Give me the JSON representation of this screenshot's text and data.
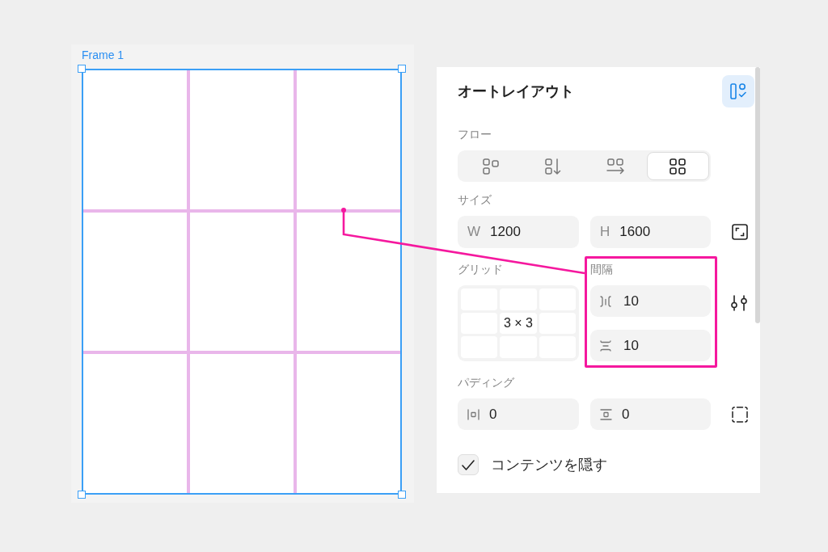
{
  "canvas": {
    "frame": {
      "label": "Frame 1",
      "selected": true
    }
  },
  "panel": {
    "title": "オートレイアウト",
    "auto_layout_toggle": {
      "on": true
    },
    "flow": {
      "label": "フロー",
      "options": [
        {
          "kind": "wrap",
          "selected": false
        },
        {
          "kind": "vertical",
          "selected": false
        },
        {
          "kind": "horizontal",
          "selected": false
        },
        {
          "kind": "grid",
          "selected": true
        }
      ]
    },
    "size": {
      "label": "サイズ",
      "fields": [
        {
          "prefix": "W",
          "value": "1200"
        },
        {
          "prefix": "H",
          "value": "1600"
        }
      ]
    },
    "grid": {
      "label": "グリッド",
      "value": "3 × 3"
    },
    "spacing": {
      "label": "間隔",
      "highlighted": true,
      "fields": [
        {
          "kind": "column_gap",
          "value": "10"
        },
        {
          "kind": "row_gap",
          "value": "10"
        }
      ]
    },
    "padding": {
      "label": "パディング",
      "fields": [
        {
          "kind": "horizontal",
          "value": "0"
        },
        {
          "kind": "vertical",
          "value": "0"
        }
      ]
    },
    "hide_content": {
      "label": "コンテンツを隠す",
      "checked": true
    }
  }
}
